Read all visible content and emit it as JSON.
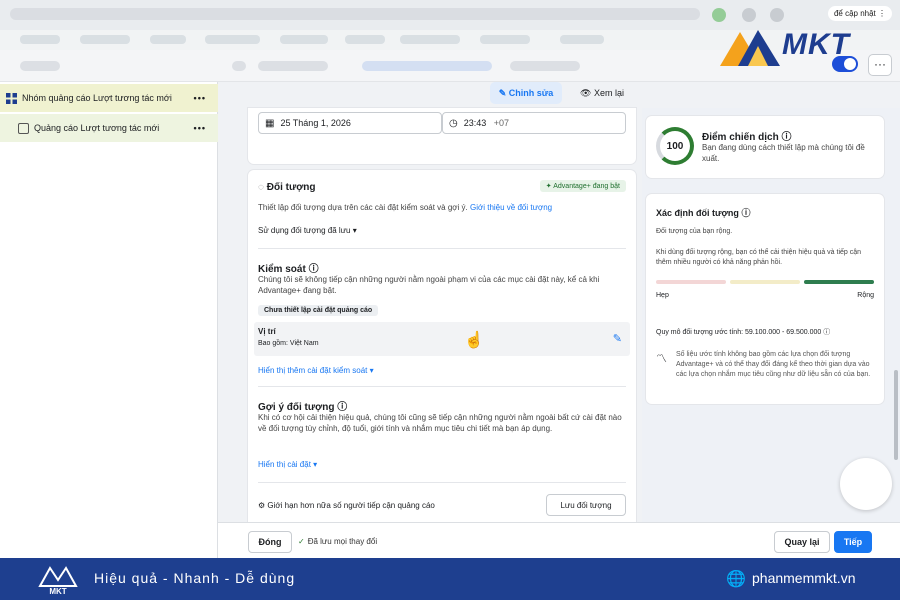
{
  "browser": {
    "update_label": "để cập nhật"
  },
  "brand": {
    "logo_text": "MKT"
  },
  "sidebar": {
    "items": [
      {
        "label": "Nhóm quảng cáo Lượt tương tác mới"
      },
      {
        "label": "Quảng cáo Lượt tương tác mới"
      }
    ],
    "menu_glyph": "•••"
  },
  "actionbar": {
    "edit_label": "Chỉnh sửa",
    "review_label": "Xem lại"
  },
  "schedule": {
    "date": "25 Tháng 1, 2026",
    "time": "23:43",
    "tz": "+07"
  },
  "audience": {
    "title": "Đối tượng",
    "advantage_badge": "Advantage+ đang bật",
    "intro": "Thiết lập đối tượng dựa trên các cài đặt kiểm soát và gợi ý.",
    "intro_link": "Giới thiệu về đối tượng",
    "saved_audience": "Sử dụng đối tượng đã lưu",
    "control_title": "Kiểm soát",
    "control_desc": "Chúng tôi sẽ không tiếp cận những người nằm ngoài phạm vi của các mục cài đặt này, kể cả khi Advantage+ đang bật.",
    "control_chip": "Chưa thiết lập cài đặt quảng cáo",
    "location_label": "Vị trí",
    "location_value": "Bao gồm: Việt Nam",
    "more_controls": "Hiển thị thêm cài đặt kiểm soát",
    "suggest_title": "Gợi ý đối tượng",
    "suggest_desc": "Khi có cơ hội cải thiện hiệu quả, chúng tôi cũng sẽ tiếp cận những người nằm ngoài bất cứ cài đặt nào về đối tượng tùy chỉnh, độ tuổi, giới tính và nhắm mục tiêu chi tiết mà bạn áp dụng.",
    "show_settings": "Hiển thị cài đặt",
    "limit_label": "Giới hạn hơn nữa số người tiếp cận quảng cáo",
    "save_button": "Lưu đối tượng"
  },
  "score": {
    "value": "100",
    "title": "Điểm chiến dịch",
    "desc": "Bạn đang dùng cách thiết lập mà chúng tôi đề xuất."
  },
  "definition": {
    "title": "Xác định đối tượng",
    "subtitle": "Đối tượng của bạn rộng.",
    "desc": "Khi dùng đối tượng rộng, bạn có thể cải thiện hiệu quả và tiếp cận thêm nhiều người có khả năng phản hồi.",
    "narrow": "Hẹp",
    "broad": "Rộng",
    "level": "broad",
    "size_label": "Quy mô đối tượng ước tính: 59.100.000 - 69.500.000",
    "note": "Số liệu ước tính không bao gồm các lựa chọn đối tượng Advantage+ và có thể thay đổi đáng kể theo thời gian dựa vào các lựa chọn nhắm mục tiêu cũng như dữ liệu sẵn có của bạn."
  },
  "footer": {
    "close_label": "Đóng",
    "saved_label": "Đã lưu mọi thay đổi",
    "back_label": "Quay lại",
    "next_label": "Tiếp"
  },
  "banner": {
    "tagline": "Hiệu quả - Nhanh - Dễ dùng",
    "site": "phanmemmkt.vn"
  },
  "colors": {
    "accent": "#1877f2",
    "banner": "#1e3f8f",
    "success": "#2e7d32",
    "meter_narrow": "#f3d6d6",
    "meter_mid": "#f3ecc8",
    "meter_broad": "#2e7d4f"
  }
}
